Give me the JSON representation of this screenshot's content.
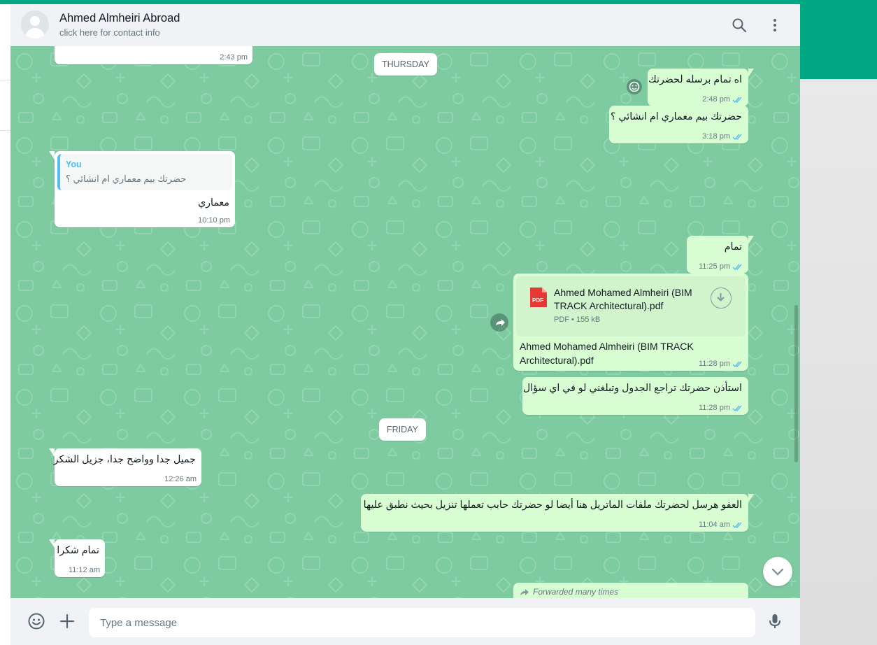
{
  "header": {
    "contact_name": "Ahmed Almheiri Abroad",
    "contact_sub": "click here for contact info"
  },
  "days": {
    "thursday": "THURSDAY",
    "friday": "FRIDAY"
  },
  "messages": {
    "m0": {
      "time": "2:43 pm"
    },
    "m1": {
      "text": "اه تمام برسله لحضرتك",
      "time": "2:48 pm"
    },
    "m2": {
      "text": "حضرتك بيم معماري ام انشائي ؟",
      "time": "3:18 pm"
    },
    "m3": {
      "quote_author": "You",
      "quote_text": "حضرتك بيم معماري ام انشائي ؟",
      "text": "معماري",
      "time": "10:10 pm"
    },
    "m4": {
      "text": "تمام",
      "time": "11:25 pm"
    },
    "m5": {
      "doc_icon_label": "PDF",
      "doc_name": "Ahmed Mohamed Almheiri (BIM TRACK Architectural).pdf",
      "doc_type": "PDF",
      "doc_size": "155 kB",
      "caption": "Ahmed Mohamed Almheiri (BIM TRACK Architectural).pdf",
      "time": "11:28 pm"
    },
    "m6": {
      "text": "استأذن حضرتك تراجع الجدول وتبلغني لو في اي سؤال",
      "time": "11:28 pm"
    },
    "m7": {
      "text": "جميل جدا وواضح جدا، جزيل الشكر",
      "time": "12:26 am"
    },
    "m8": {
      "text": "العفو هرسل لحضرتك ملفات الماتريل هنا أيضا لو حضرتك حابب تعملها تنزيل بحيث نطبق عليها",
      "time": "11:04 am"
    },
    "m9": {
      "text": "تمام شكرا",
      "time": "11:12 am"
    },
    "m10": {
      "forwarded_label": "Forwarded many times"
    }
  },
  "composer": {
    "placeholder": "Type a message"
  },
  "colors": {
    "brand": "#00a884",
    "chat_bg": "#7ecba1",
    "outgoing": "#d9fdd3",
    "incoming": "#ffffff",
    "read_ticks": "#53bdeb"
  },
  "icons": [
    "search-icon",
    "menu-icon",
    "emoji-icon",
    "attach-icon",
    "mic-icon",
    "pdf-icon",
    "download-icon",
    "forward-icon",
    "chevron-down-icon",
    "double-check-icon"
  ]
}
